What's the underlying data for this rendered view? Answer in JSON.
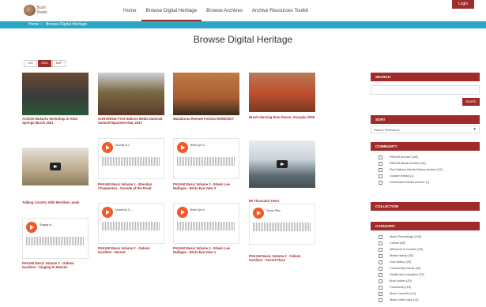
{
  "nav": {
    "logo_text": "Bush Radio",
    "items": [
      "Home",
      "Browse Digital Heritage",
      "Browse Archives",
      "Archive Resources Toolkit"
    ],
    "active_index": 1,
    "login_label": "Login"
  },
  "breadcrumb": {
    "home": "Home",
    "current": "Browse Digital Heritage"
  },
  "page": {
    "title": "Browse Digital Heritage"
  },
  "view_toggle": [
    "LIST",
    "GRID",
    "MAP"
  ],
  "cards": [
    {
      "type": "image",
      "caption": "Archive Mukurtu Workshop in Alice Springs March 2021",
      "accent": "#8b5b3e"
    },
    {
      "type": "image",
      "caption": "CONVERGE First Nations Media National Summit Mparntwe May 2017",
      "accent": "#7d5a2c"
    },
    {
      "type": "image",
      "caption": "Warakurna Remote Festival 09/09/2007",
      "accent": "#a45a32"
    },
    {
      "type": "image",
      "caption": "Brush dancing Emu Dance, Irrunytju 2009",
      "accent": "#9c4a2b"
    },
    {
      "type": "video",
      "caption": "Talking Country With Merrilee Lands"
    },
    {
      "type": "audio",
      "audio_title": "Sounds of I...",
      "caption": "PAKAM Music Volume 1 - Brendan Chequeston - Sounds of the Road"
    },
    {
      "type": "audio",
      "audio_title": "Birds Eye V...",
      "caption": "PAKAM Music Volume 3 - Edwin Lee Mulligan - Birds Eye View 2"
    },
    {
      "type": "video",
      "caption": "Mt Thousand Years"
    },
    {
      "type": "audio",
      "audio_title": "Singing In...",
      "caption": "PAKAM Music Volume 2 - Gideon Gardiner - Singing In Heaven"
    },
    {
      "type": "audio",
      "audio_title": "Mozart by G...",
      "caption": "PAKAM Music Volume 2 - Gideon Gardiner - Mozart"
    },
    {
      "type": "audio",
      "audio_title": "Birds Eye V...",
      "caption": "PAKAM Music Volume 3 - Edwin Lee Mulligan - Birds Eye View 1"
    },
    {
      "type": "audio",
      "audio_title": "Secret Plac...",
      "caption": "PAKAM Music Volume 2 - Gideon Gardiner - Secret Place"
    }
  ],
  "sidebar": {
    "search": {
      "heading": "SEARCH",
      "button": "Search"
    },
    "sort": {
      "heading": "SORT",
      "selected": "Search Relevance"
    },
    "community": {
      "heading": "COMMUNITY",
      "items": [
        "PAKAM Archive (150)",
        "PAKAM Media Archive (48)",
        "First Nations Media History Archive (22)",
        "Goolarri Media (1)",
        "Umeewarra Media Archive (1)"
      ]
    },
    "collection": {
      "heading": "COLLECTION"
    },
    "category": {
      "heading": "CATEGORY",
      "items": [
        "Music Recordings (149)",
        "Culture (65)",
        "Welcome to Country (39)",
        "Media history (32)",
        "Oral history (29)",
        "Community events (26)",
        "Health and education (23)",
        "Bush tucker (20)",
        "Community (18)",
        "Music concerts (14)",
        "Music video clips (13)"
      ]
    }
  },
  "colors": {
    "accent": "#9f2b2b",
    "crumb": "#2aa7c4",
    "audio_button": "#f1592a"
  }
}
